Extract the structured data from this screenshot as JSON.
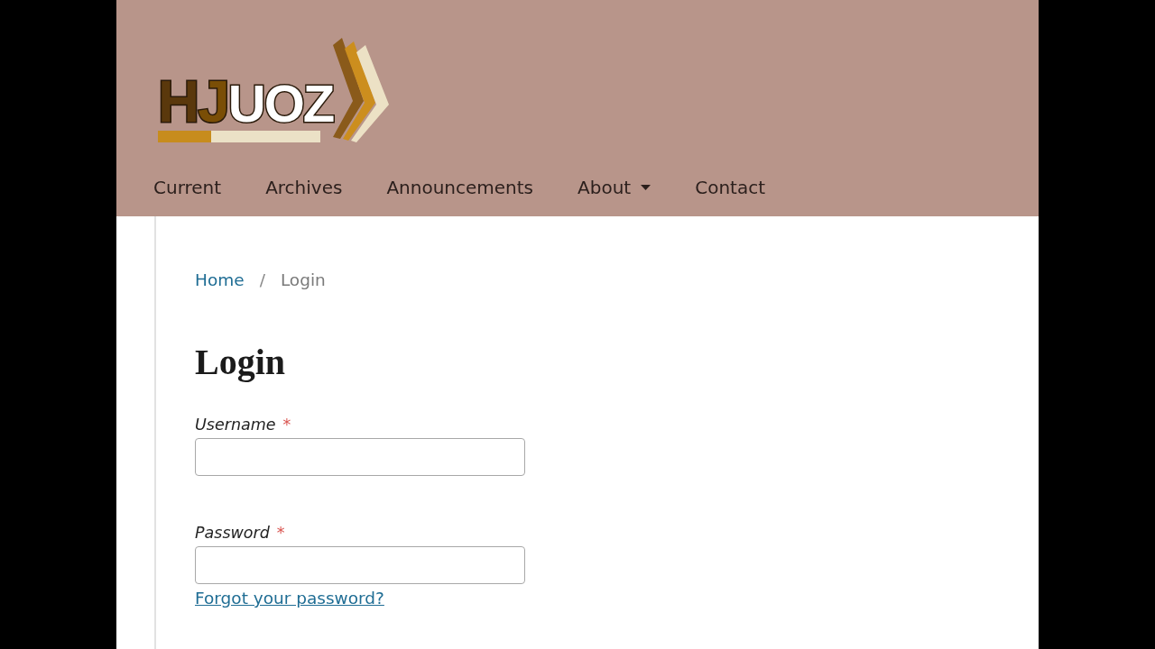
{
  "header": {
    "logo": {
      "text": "HJUOZ"
    },
    "nav": [
      {
        "label": "Current",
        "dropdown": false
      },
      {
        "label": "Archives",
        "dropdown": false
      },
      {
        "label": "Announcements",
        "dropdown": false
      },
      {
        "label": "About",
        "dropdown": true
      },
      {
        "label": "Contact",
        "dropdown": false
      }
    ]
  },
  "breadcrumb": {
    "items": [
      {
        "label": "Home",
        "kind": "link"
      },
      {
        "label": "Login",
        "kind": "current"
      }
    ],
    "separator": "/"
  },
  "heading": "Login",
  "form": {
    "fields": [
      {
        "label": "Username",
        "required_mark": "*"
      },
      {
        "label": "Password",
        "required_mark": "*"
      }
    ],
    "forgot_link": "Forgot your password?"
  }
}
